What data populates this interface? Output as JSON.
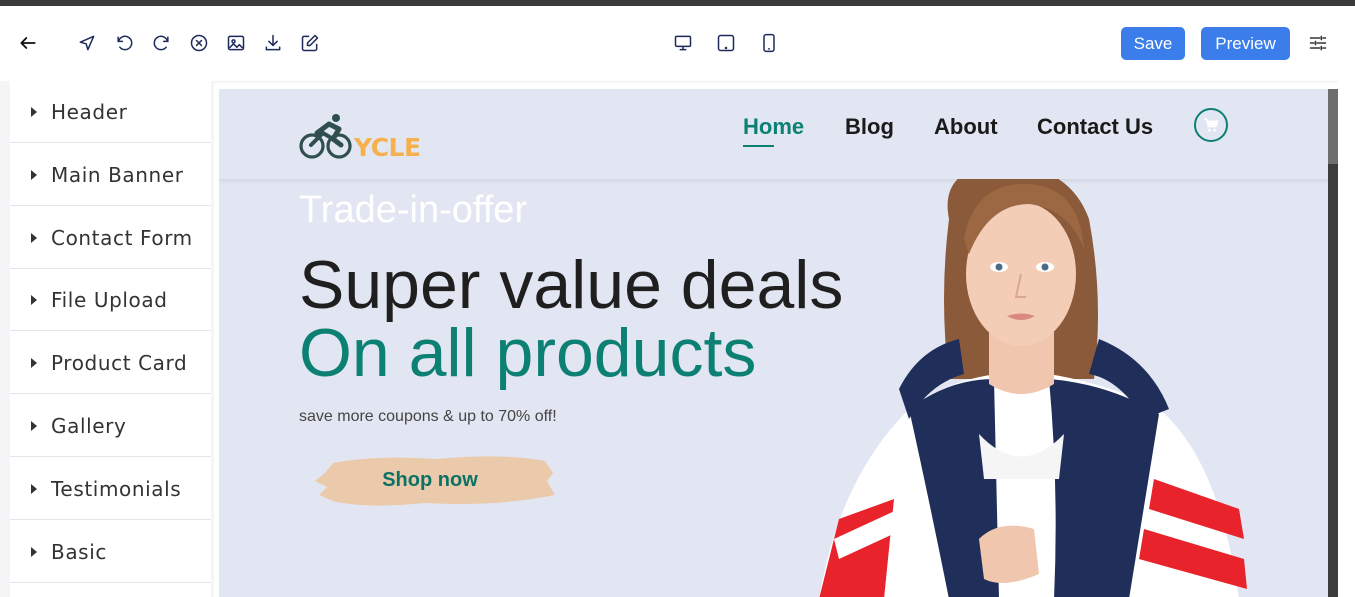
{
  "toolbar": {
    "icons": [
      "back-arrow-icon",
      "pointer-icon",
      "undo-icon",
      "redo-icon",
      "clear-icon",
      "image-icon",
      "download-icon",
      "edit-icon",
      "desktop-icon",
      "tablet-icon",
      "mobile-icon",
      "settings-sliders-icon"
    ],
    "save_label": "Save",
    "preview_label": "Preview"
  },
  "sidebar": {
    "items": [
      {
        "label": "Header"
      },
      {
        "label": "Main Banner"
      },
      {
        "label": "Contact Form"
      },
      {
        "label": "File Upload"
      },
      {
        "label": "Product Card"
      },
      {
        "label": "Gallery"
      },
      {
        "label": "Testimonials"
      },
      {
        "label": "Basic"
      }
    ]
  },
  "site": {
    "logo": {
      "prefix": "C",
      "suffix": "YCLE"
    },
    "nav": [
      "Home",
      "Blog",
      "About",
      "Contact Us"
    ],
    "active_nav": "Home",
    "hero": {
      "eyebrow": "Trade-in-offer",
      "headline": "Super value deals",
      "headline_accent": "On all products",
      "subtext": "save more coupons & up to 70% off!",
      "cta": "Shop now"
    }
  },
  "colors": {
    "accent": "#0d8074",
    "button_blue": "#3b7dea",
    "canvas_bg": "#e2e6f2",
    "logo_orange": "#f5b14e",
    "cta_brush": "#ebc9ab"
  }
}
